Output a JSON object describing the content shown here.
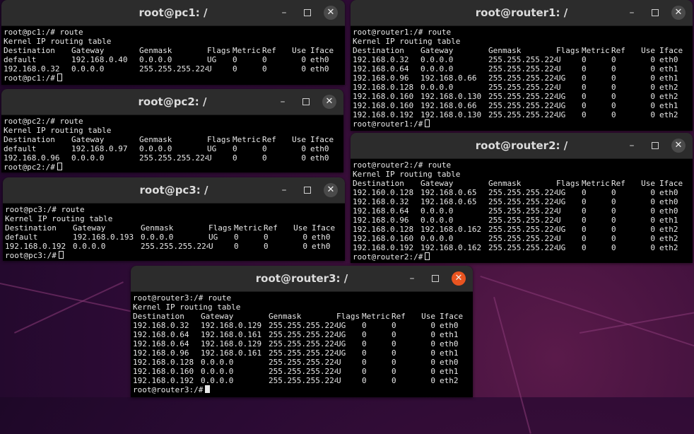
{
  "windows": [
    {
      "id": "pc1",
      "title": "root@pc1: /",
      "active": false,
      "command_line": "root@pc1:/# route",
      "heading": "Kernel IP routing table",
      "columns": [
        "Destination",
        "Gateway",
        "Genmask",
        "Flags",
        "Metric",
        "Ref",
        "Use",
        "Iface"
      ],
      "rows": [
        [
          "default",
          "192.168.0.40",
          "0.0.0.0",
          "UG",
          "0",
          "0",
          "0",
          "eth0"
        ],
        [
          "192.168.0.32",
          "0.0.0.0",
          "255.255.255.224",
          "U",
          "0",
          "0",
          "0",
          "eth0"
        ]
      ],
      "prompt": "root@pc1:/#"
    },
    {
      "id": "pc2",
      "title": "root@pc2: /",
      "active": false,
      "command_line": "root@pc2:/# route",
      "heading": "Kernel IP routing table",
      "columns": [
        "Destination",
        "Gateway",
        "Genmask",
        "Flags",
        "Metric",
        "Ref",
        "Use",
        "Iface"
      ],
      "rows": [
        [
          "default",
          "192.168.0.97",
          "0.0.0.0",
          "UG",
          "0",
          "0",
          "0",
          "eth0"
        ],
        [
          "192.168.0.96",
          "0.0.0.0",
          "255.255.255.224",
          "U",
          "0",
          "0",
          "0",
          "eth0"
        ]
      ],
      "prompt": "root@pc2:/#"
    },
    {
      "id": "pc3",
      "title": "root@pc3: /",
      "active": false,
      "command_line": "root@pc3:/# route",
      "heading": "Kernel IP routing table",
      "columns": [
        "Destination",
        "Gateway",
        "Genmask",
        "Flags",
        "Metric",
        "Ref",
        "Use",
        "Iface"
      ],
      "rows": [
        [
          "default",
          "192.168.0.193",
          "0.0.0.0",
          "UG",
          "0",
          "0",
          "0",
          "eth0"
        ],
        [
          "192.168.0.192",
          "0.0.0.0",
          "255.255.255.224",
          "U",
          "0",
          "0",
          "0",
          "eth0"
        ]
      ],
      "prompt": "root@pc3:/#"
    },
    {
      "id": "router1",
      "title": "root@router1: /",
      "active": false,
      "command_line": "root@router1:/# route",
      "heading": "Kernel IP routing table",
      "columns": [
        "Destination",
        "Gateway",
        "Genmask",
        "Flags",
        "Metric",
        "Ref",
        "Use",
        "Iface"
      ],
      "rows": [
        [
          "192.168.0.32",
          "0.0.0.0",
          "255.255.255.224",
          "U",
          "0",
          "0",
          "0",
          "eth0"
        ],
        [
          "192.168.0.64",
          "0.0.0.0",
          "255.255.255.224",
          "U",
          "0",
          "0",
          "0",
          "eth1"
        ],
        [
          "192.168.0.96",
          "192.168.0.66",
          "255.255.255.224",
          "UG",
          "0",
          "0",
          "0",
          "eth1"
        ],
        [
          "192.168.0.128",
          "0.0.0.0",
          "255.255.255.224",
          "U",
          "0",
          "0",
          "0",
          "eth2"
        ],
        [
          "192.168.0.160",
          "192.168.0.130",
          "255.255.255.224",
          "UG",
          "0",
          "0",
          "0",
          "eth2"
        ],
        [
          "192.168.0.160",
          "192.168.0.66",
          "255.255.255.224",
          "UG",
          "0",
          "0",
          "0",
          "eth1"
        ],
        [
          "192.168.0.192",
          "192.168.0.130",
          "255.255.255.224",
          "UG",
          "0",
          "0",
          "0",
          "eth2"
        ]
      ],
      "prompt": "root@router1:/#"
    },
    {
      "id": "router2",
      "title": "root@router2: /",
      "active": false,
      "command_line": "root@router2:/# route",
      "heading": "Kernel IP routing table",
      "columns": [
        "Destination",
        "Gateway",
        "Genmask",
        "Flags",
        "Metric",
        "Ref",
        "Use",
        "Iface"
      ],
      "rows": [
        [
          "192.160.0.128",
          "192.168.0.65",
          "255.255.255.224",
          "UG",
          "0",
          "0",
          "0",
          "eth0"
        ],
        [
          "192.168.0.32",
          "192.168.0.65",
          "255.255.255.224",
          "UG",
          "0",
          "0",
          "0",
          "eth0"
        ],
        [
          "192.168.0.64",
          "0.0.0.0",
          "255.255.255.224",
          "U",
          "0",
          "0",
          "0",
          "eth0"
        ],
        [
          "192.168.0.96",
          "0.0.0.0",
          "255.255.255.224",
          "U",
          "0",
          "0",
          "0",
          "eth1"
        ],
        [
          "192.168.0.128",
          "192.168.0.162",
          "255.255.255.224",
          "UG",
          "0",
          "0",
          "0",
          "eth2"
        ],
        [
          "192.168.0.160",
          "0.0.0.0",
          "255.255.255.224",
          "U",
          "0",
          "0",
          "0",
          "eth2"
        ],
        [
          "192.168.0.192",
          "192.168.0.162",
          "255.255.255.224",
          "UG",
          "0",
          "0",
          "0",
          "eth2"
        ]
      ],
      "prompt": "root@router2:/#"
    },
    {
      "id": "router3",
      "title": "root@router3: /",
      "active": true,
      "command_line": "root@router3:/# route",
      "heading": "Kernel IP routing table",
      "columns": [
        "Destination",
        "Gateway",
        "Genmask",
        "Flags",
        "Metric",
        "Ref",
        "Use",
        "Iface"
      ],
      "rows": [
        [
          "192.168.0.32",
          "192.168.0.129",
          "255.255.255.224",
          "UG",
          "0",
          "0",
          "0",
          "eth0"
        ],
        [
          "192.168.0.64",
          "192.168.0.161",
          "255.255.255.224",
          "UG",
          "0",
          "0",
          "0",
          "eth1"
        ],
        [
          "192.168.0.64",
          "192.168.0.129",
          "255.255.255.224",
          "UG",
          "0",
          "0",
          "0",
          "eth0"
        ],
        [
          "192.168.0.96",
          "192.168.0.161",
          "255.255.255.224",
          "UG",
          "0",
          "0",
          "0",
          "eth1"
        ],
        [
          "192.168.0.128",
          "0.0.0.0",
          "255.255.255.224",
          "U",
          "0",
          "0",
          "0",
          "eth0"
        ],
        [
          "192.168.0.160",
          "0.0.0.0",
          "255.255.255.224",
          "U",
          "0",
          "0",
          "0",
          "eth1"
        ],
        [
          "192.168.0.192",
          "0.0.0.0",
          "255.255.255.224",
          "U",
          "0",
          "0",
          "0",
          "eth2"
        ]
      ],
      "prompt": "root@router3:/#"
    }
  ],
  "window_controls": {
    "minimize": "–",
    "close": "✕"
  },
  "colors": {
    "terminal_bg": "#000000",
    "titlebar_bg": "#2c2c2c",
    "active_close": "#e95420",
    "desktop": "#3b0f3a"
  }
}
